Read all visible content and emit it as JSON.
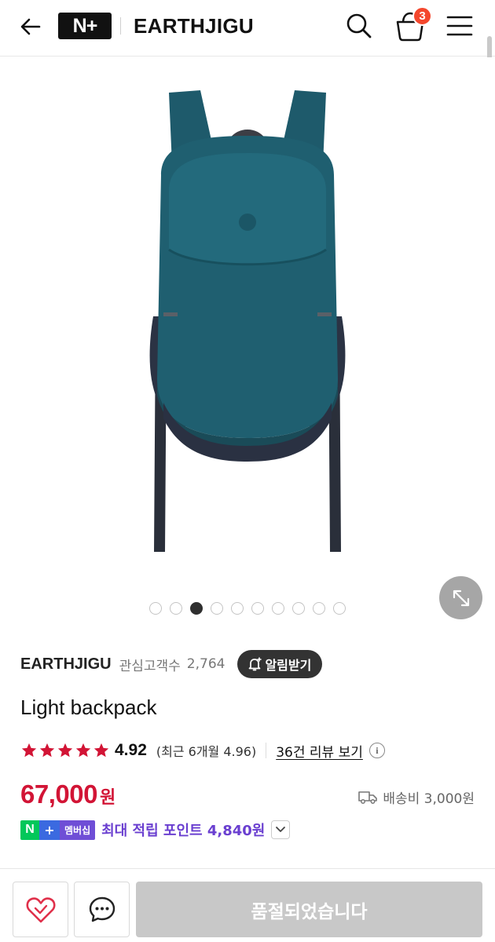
{
  "header": {
    "logo_text": "N+",
    "brand_title": "EARTHJIGU",
    "cart_count": "3",
    "icons": [
      "back-arrow-icon",
      "search-icon",
      "shopping-bag-icon",
      "hamburger-menu-icon"
    ],
    "badge_color": "#f4472d"
  },
  "gallery": {
    "total_images": 10,
    "active_index": 2,
    "image_subject": "teal-backpack"
  },
  "store": {
    "name": "EARTHJIGU",
    "interest_label": "관심고객수",
    "interest_count": "2,764",
    "alert_label": "알림받기"
  },
  "product": {
    "title": "Light backpack"
  },
  "rating": {
    "stars": 5,
    "score": "4.92",
    "recent": "(최근 6개월 4.96)",
    "review_link": "36건 리뷰 보기",
    "info_glyph": "i",
    "star_color": "#d21435"
  },
  "price": {
    "amount": "67,000",
    "unit": "원",
    "color": "#d21435",
    "shipping": "배송비 3,000원"
  },
  "membership": {
    "badge_n": "N",
    "badge_plus": "+",
    "badge_text": "멤버십",
    "text": "최대 적립 포인트 4,840원",
    "color": "#6a3fd0"
  },
  "bottom_bar": {
    "soldout_label": "품절되었습니다",
    "icons": [
      "heart-icon",
      "chat-bubble-icon"
    ]
  }
}
